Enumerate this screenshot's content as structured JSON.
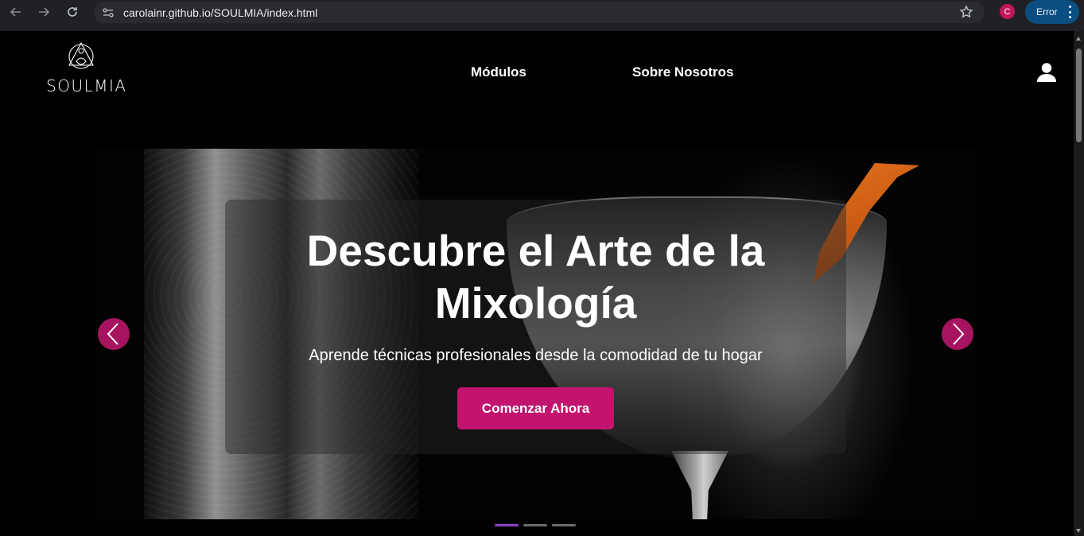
{
  "browser": {
    "url": "carolainr.github.io/SOULMIA/index.html",
    "profile_initial": "C",
    "error_label": "Error"
  },
  "header": {
    "logo_text": "SOULMIA",
    "nav": [
      {
        "label": "Módulos"
      },
      {
        "label": "Sobre Nosotros"
      }
    ]
  },
  "hero": {
    "title": "Descubre el Arte de la Mixología",
    "subtitle": "Aprende técnicas profesionales desde la comodidad de tu hogar",
    "cta_label": "Comenzar Ahora",
    "active_slide": 1,
    "slide_count": 3
  },
  "colors": {
    "accent": "#c2146f",
    "arrow_bg": "#a6145f",
    "indicator_active": "#8e3fc4",
    "background": "#000000"
  }
}
